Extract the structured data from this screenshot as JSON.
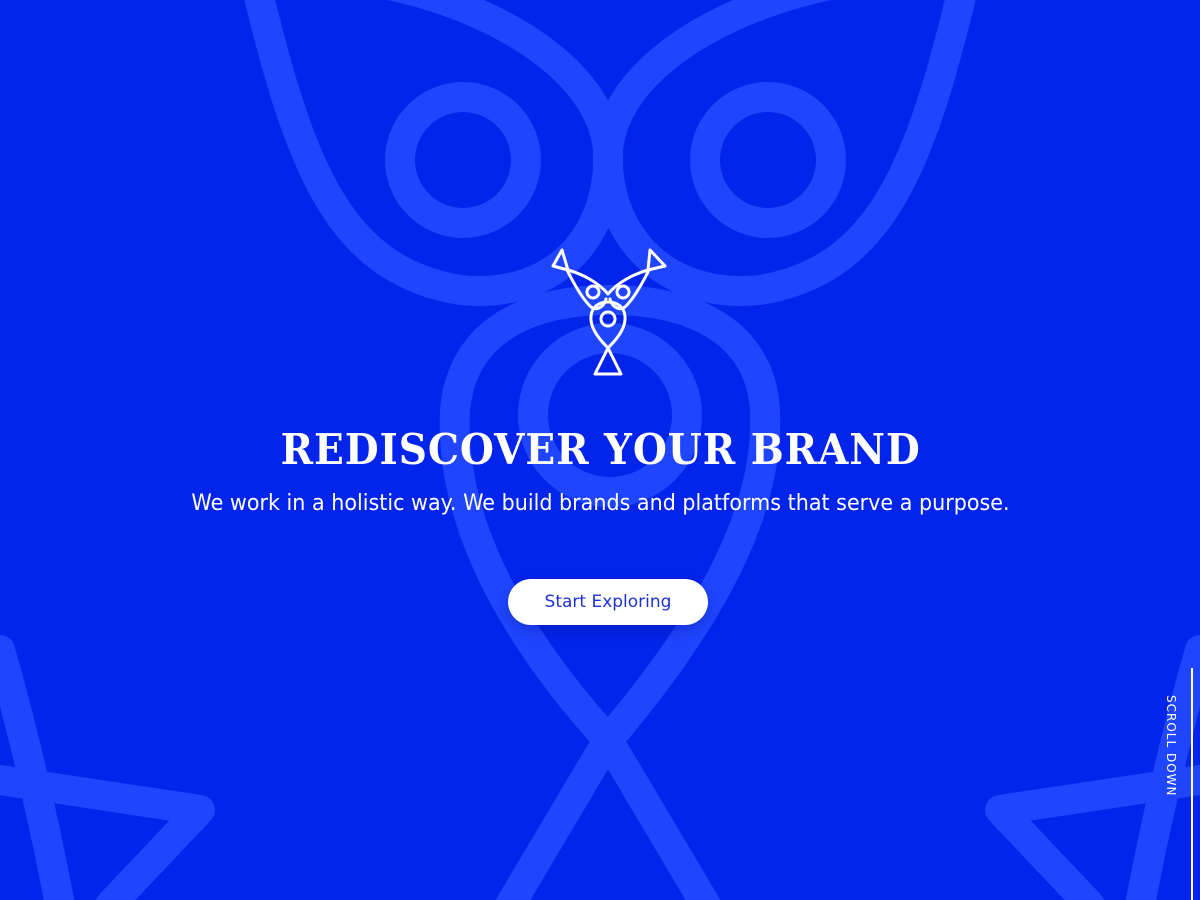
{
  "theme": {
    "background": "#0324eb",
    "watermark": "#1f45ff",
    "accent": "#ffffff",
    "button_text": "#1e32d2"
  },
  "hero": {
    "logo_icon": "figure-tree-logo",
    "watermark_icon": "figure-tree-watermark",
    "headline": "REDISCOVER YOUR BRAND",
    "subtitle": "We work in a holistic way. We build brands and platforms that serve a purpose.",
    "cta_label": "Start Exploring"
  },
  "scroll": {
    "label": "SCROLL DOWN",
    "icon": "vertical-line-indicator"
  }
}
